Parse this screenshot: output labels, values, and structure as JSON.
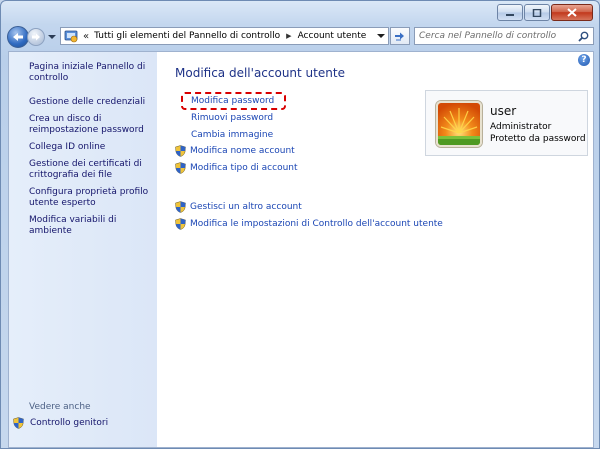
{
  "window": {
    "controls": {
      "minimize_icon": "minimize-icon",
      "maximize_icon": "maximize-icon",
      "close_icon": "close-icon"
    }
  },
  "navigation": {
    "back_icon": "back-arrow-icon",
    "forward_icon": "forward-arrow-icon",
    "history_icon": "chevron-down-icon"
  },
  "address_bar": {
    "separator": "«",
    "breadcrumbs": [
      "Tutti gli elementi del Pannello di controllo",
      "Account utente"
    ]
  },
  "search": {
    "placeholder": "Cerca nel Pannello di controllo"
  },
  "sidebar": {
    "links": [
      "Pagina iniziale Pannello di controllo",
      "Gestione delle credenziali",
      "Crea un disco di reimpostazione password",
      "Collega ID online",
      "Gestione dei certificati di crittografia dei file",
      "Configura proprietà profilo utente esperto",
      "Modifica variabili di ambiente"
    ],
    "see_also_title": "Vedere anche",
    "see_also_links": [
      "Controllo genitori"
    ]
  },
  "main": {
    "title": "Modifica dell'account utente",
    "tasks": [
      "Modifica password",
      "Rimuovi password",
      "Cambia immagine",
      "Modifica nome account",
      "Modifica tipo di account"
    ],
    "other_tasks": [
      "Gestisci un altro account",
      "Modifica le impostazioni di Controllo dell'account utente"
    ]
  },
  "user": {
    "name": "user",
    "role": "Administrator",
    "status": "Protetto da password"
  },
  "colors": {
    "link": "#1b46b4",
    "sidebar_link": "#15156b",
    "title": "#1e3287",
    "highlight": "#d80000"
  }
}
